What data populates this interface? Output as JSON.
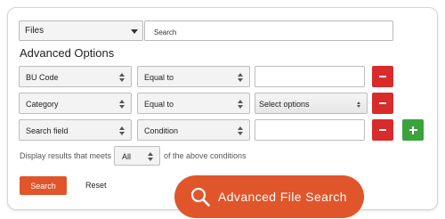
{
  "search_bar": {
    "type_value": "Files",
    "query_value": "Search"
  },
  "section_title": "Advanced Options",
  "filters": [
    {
      "field": "BU Code",
      "operator": "Equal to",
      "value": "",
      "has_add": false
    },
    {
      "field": "Category",
      "operator": "Equal to",
      "value": "Select options",
      "has_add": false
    },
    {
      "field": "Search field",
      "operator": "Condition",
      "value": "",
      "has_add": true
    }
  ],
  "match": {
    "prefix": "Display results that meets",
    "value": "All",
    "suffix": "of the above conditions"
  },
  "actions": {
    "search_label": "Search",
    "reset_label": "Reset"
  },
  "promo": {
    "label": "Advanced File Search",
    "icon": "magnifier-icon"
  },
  "colors": {
    "accent": "#e0552a",
    "remove": "#d92b2b",
    "add": "#3aa33b"
  }
}
